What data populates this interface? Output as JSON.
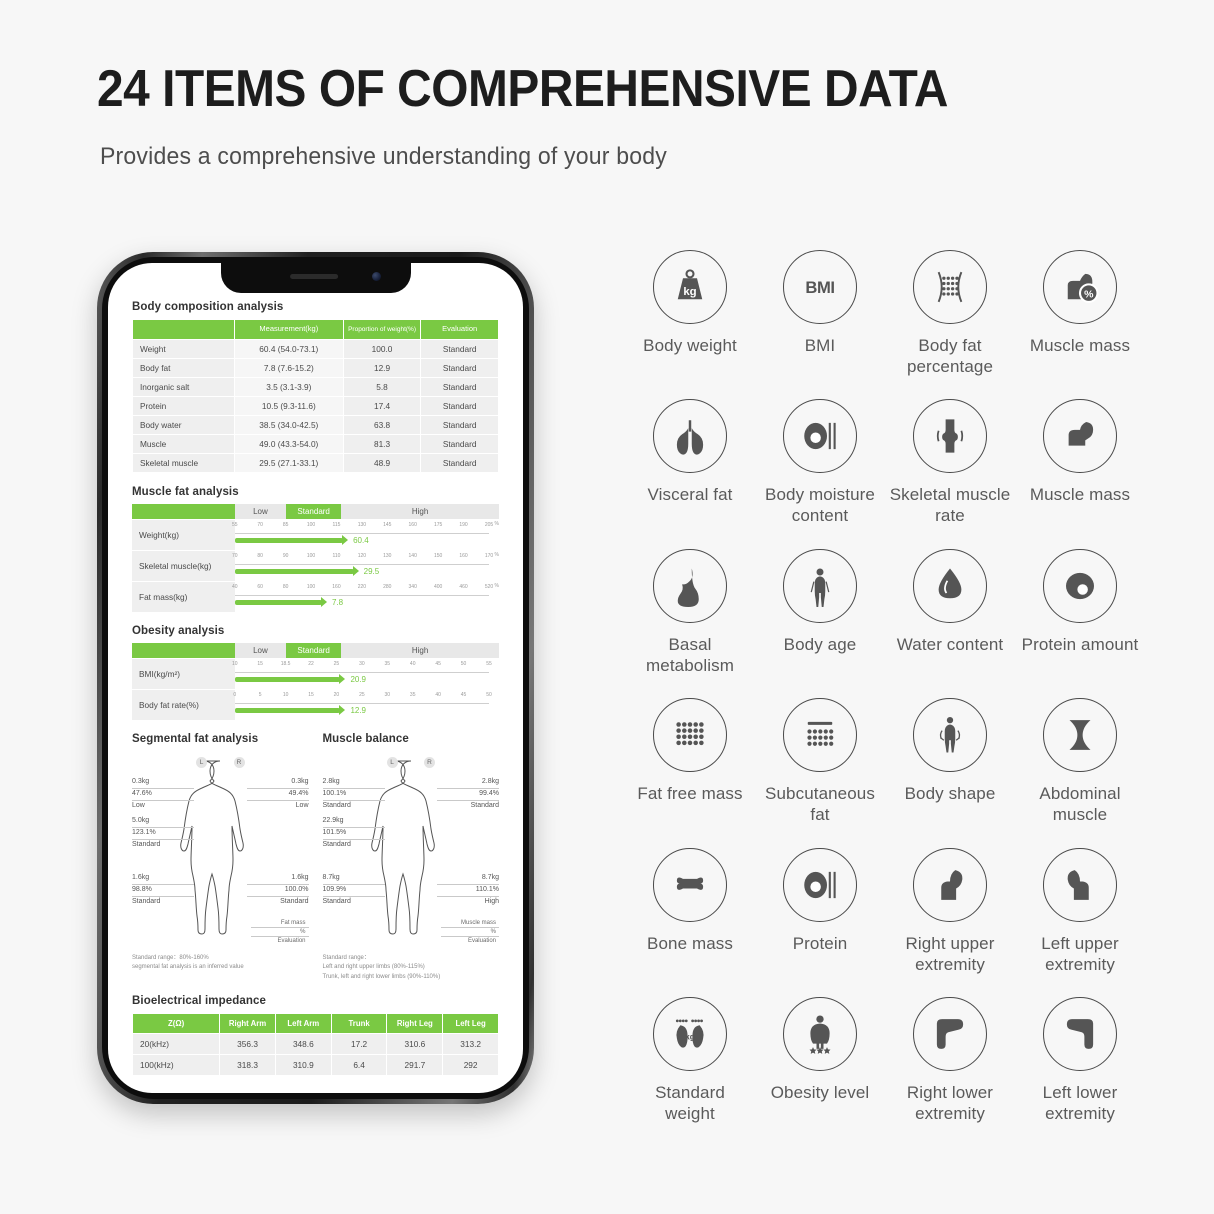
{
  "header": {
    "title": "24 ITEMS OF COMPREHENSIVE DATA",
    "subtitle": "Provides a comprehensive understanding of your body"
  },
  "colors": {
    "accent_green": "#7ac943",
    "background": "#f7f7f7",
    "icon_stroke": "#4a4a4a",
    "table_row": "#efefef"
  },
  "report": {
    "body_composition": {
      "title": "Body composition analysis",
      "headers": [
        "",
        "Measurement(kg)",
        "Proportion of weight(%)",
        "Evaluation"
      ],
      "rows": [
        {
          "name": "Weight",
          "measurement": "60.4  (54.0-73.1)",
          "proportion": "100.0",
          "evaluation": "Standard"
        },
        {
          "name": "Body fat",
          "measurement": "7.8  (7.6-15.2)",
          "proportion": "12.9",
          "evaluation": "Standard"
        },
        {
          "name": "Inorganic salt",
          "measurement": "3.5  (3.1-3.9)",
          "proportion": "5.8",
          "evaluation": "Standard"
        },
        {
          "name": "Protein",
          "measurement": "10.5  (9.3-11.6)",
          "proportion": "17.4",
          "evaluation": "Standard"
        },
        {
          "name": "Body water",
          "measurement": "38.5  (34.0-42.5)",
          "proportion": "63.8",
          "evaluation": "Standard"
        },
        {
          "name": "Muscle",
          "measurement": "49.0  (43.3-54.0)",
          "proportion": "81.3",
          "evaluation": "Standard"
        },
        {
          "name": "Skeletal muscle",
          "measurement": "29.5  (27.1-33.1)",
          "proportion": "48.9",
          "evaluation": "Standard"
        }
      ]
    },
    "muscle_fat": {
      "title": "Muscle fat analysis",
      "zones": [
        "Low",
        "Standard",
        "High"
      ],
      "rows": [
        {
          "label": "Weight(kg)",
          "value": "60.4",
          "unit": "%",
          "fill_pct": 41,
          "ticks": [
            "55",
            "70",
            "85",
            "100",
            "115",
            "130",
            "145",
            "160",
            "175",
            "190",
            "205"
          ]
        },
        {
          "label": "Skeletal muscle(kg)",
          "value": "29.5",
          "unit": "%",
          "fill_pct": 45,
          "ticks": [
            "70",
            "80",
            "90",
            "100",
            "110",
            "120",
            "130",
            "140",
            "150",
            "160",
            "170"
          ]
        },
        {
          "label": "Fat mass(kg)",
          "value": "7.8",
          "unit": "%",
          "fill_pct": 33,
          "ticks": [
            "40",
            "60",
            "80",
            "100",
            "160",
            "220",
            "280",
            "340",
            "400",
            "460",
            "520"
          ]
        }
      ]
    },
    "obesity": {
      "title": "Obesity analysis",
      "zones": [
        "Low",
        "Standard",
        "High"
      ],
      "rows": [
        {
          "label": "BMI(kg/m²)",
          "value": "20.9",
          "unit": "",
          "fill_pct": 40,
          "ticks": [
            "10",
            "15",
            "18.5",
            "22",
            "25",
            "30",
            "35",
            "40",
            "45",
            "50",
            "55"
          ]
        },
        {
          "label": "Body fat rate(%)",
          "value": "12.9",
          "unit": "",
          "fill_pct": 40,
          "ticks": [
            "0",
            "5",
            "10",
            "15",
            "20",
            "25",
            "30",
            "35",
            "40",
            "45",
            "50"
          ]
        }
      ]
    },
    "segmental_fat": {
      "title": "Segmental fat analysis",
      "badge_left": "L",
      "badge_right": "R",
      "left_arm": {
        "kg": "0.3kg",
        "pct": "47.6%",
        "eval": "Low"
      },
      "right_arm": {
        "kg": "0.3kg",
        "pct": "49.4%",
        "eval": "Low"
      },
      "trunk": {
        "kg": "5.0kg",
        "pct": "123.1%",
        "eval": "Standard"
      },
      "left_leg": {
        "kg": "1.6kg",
        "pct": "98.8%",
        "eval": "Standard"
      },
      "right_leg": {
        "kg": "1.6kg",
        "pct": "100.0%",
        "eval": "Standard"
      },
      "legend": [
        "Fat mass",
        "%",
        "Evaluation"
      ],
      "footnote": [
        "Standard range：80%-160%",
        "segmental fat analysis is an inferred value"
      ]
    },
    "muscle_balance": {
      "title": "Muscle balance",
      "badge_left": "L",
      "badge_right": "R",
      "left_arm": {
        "kg": "2.8kg",
        "pct": "100.1%",
        "eval": "Standard"
      },
      "right_arm": {
        "kg": "2.8kg",
        "pct": "99.4%",
        "eval": "Standard"
      },
      "trunk": {
        "kg": "22.9kg",
        "pct": "101.5%",
        "eval": "Standard"
      },
      "left_leg": {
        "kg": "8.7kg",
        "pct": "109.9%",
        "eval": "Standard"
      },
      "right_leg": {
        "kg": "8.7kg",
        "pct": "110.1%",
        "eval": "High"
      },
      "legend": [
        "Muscle mass",
        "%",
        "Evaluation"
      ],
      "footnote": [
        "Standard range：",
        "Left and right upper limbs (80%-115%)",
        "Trunk, left and right lower limbs (90%-110%)"
      ]
    },
    "impedance": {
      "title": "Bioelectrical impedance",
      "headers": [
        "Z(Ω)",
        "Right Arm",
        "Left Arm",
        "Trunk",
        "Right Leg",
        "Left Leg"
      ],
      "rows": [
        {
          "freq": "20(kHz)",
          "values": [
            "356.3",
            "348.6",
            "17.2",
            "310.6",
            "313.2"
          ]
        },
        {
          "freq": "100(kHz)",
          "values": [
            "318.3",
            "310.9",
            "6.4",
            "291.7",
            "292"
          ]
        }
      ]
    }
  },
  "icons": [
    {
      "icon": "weight-kg-icon",
      "label": "Body weight"
    },
    {
      "icon": "bmi-text-icon",
      "label": "BMI"
    },
    {
      "icon": "fat-dots-pinch-icon",
      "label": "Body fat percentage"
    },
    {
      "icon": "muscle-percent-icon",
      "label": "Muscle mass"
    },
    {
      "icon": "lungs-icon",
      "label": "Visceral fat"
    },
    {
      "icon": "cell-droplet-lines-icon",
      "label": "Body moisture content"
    },
    {
      "icon": "knee-joint-icon",
      "label": "Skeletal muscle rate"
    },
    {
      "icon": "flexed-arm-icon",
      "label": "Muscle mass"
    },
    {
      "icon": "flame-icon",
      "label": "Basal metabolism"
    },
    {
      "icon": "person-standing-icon",
      "label": "Body age"
    },
    {
      "icon": "water-drop-icon",
      "label": "Water content"
    },
    {
      "icon": "protein-cell-icon",
      "label": "Protein amount"
    },
    {
      "icon": "dot-matrix-icon",
      "label": "Fat free mass"
    },
    {
      "icon": "skin-layer-dots-icon",
      "label": "Subcutaneous fat"
    },
    {
      "icon": "body-shape-measure-icon",
      "label": "Body shape"
    },
    {
      "icon": "hourglass-abs-icon",
      "label": "Abdominal muscle"
    },
    {
      "icon": "bone-icon",
      "label": "Bone mass"
    },
    {
      "icon": "cell-droplet-lines-icon",
      "label": "Protein"
    },
    {
      "icon": "right-arm-icon",
      "label": "Right upper extremity"
    },
    {
      "icon": "left-arm-icon",
      "label": "Left upper extremity"
    },
    {
      "icon": "feet-kg-icon",
      "label": "Standard weight"
    },
    {
      "icon": "obese-person-stars-icon",
      "label": "Obesity level"
    },
    {
      "icon": "right-leg-icon",
      "label": "Right lower extremity"
    },
    {
      "icon": "left-leg-icon",
      "label": "Left lower extremity"
    }
  ]
}
